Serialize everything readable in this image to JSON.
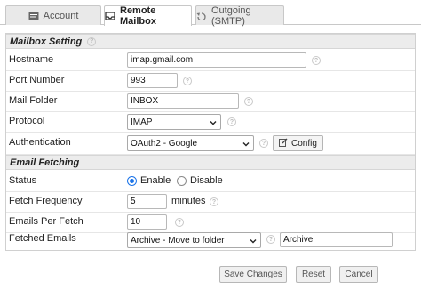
{
  "tabs": [
    {
      "label": "Account",
      "icon": "account-card-icon",
      "active": false
    },
    {
      "label": "Remote Mailbox",
      "icon": "mailbox-tray-icon",
      "active": true
    },
    {
      "label": "Outgoing (SMTP)",
      "icon": "outgoing-arrow-icon",
      "active": false
    }
  ],
  "mailbox_setting": {
    "title": "Mailbox Setting",
    "hostname": {
      "label": "Hostname",
      "value": "imap.gmail.com"
    },
    "port": {
      "label": "Port Number",
      "value": "993"
    },
    "folder": {
      "label": "Mail Folder",
      "value": "INBOX"
    },
    "protocol": {
      "label": "Protocol",
      "value": "IMAP"
    },
    "auth": {
      "label": "Authentication",
      "value": "OAuth2 - Google",
      "config_label": "Config"
    }
  },
  "email_fetching": {
    "title": "Email Fetching",
    "status": {
      "label": "Status",
      "enable": "Enable",
      "disable": "Disable",
      "selected": "Enable"
    },
    "frequency": {
      "label": "Fetch Frequency",
      "value": "5",
      "unit": "minutes"
    },
    "per_fetch": {
      "label": "Emails Per Fetch",
      "value": "10"
    },
    "fetched": {
      "label": "Fetched Emails",
      "action": "Archive - Move to folder",
      "folder": "Archive"
    }
  },
  "buttons": {
    "save": "Save Changes",
    "reset": "Reset",
    "cancel": "Cancel"
  },
  "colors": {
    "accent": "#1a73e8",
    "section_bg": "#ececec"
  }
}
